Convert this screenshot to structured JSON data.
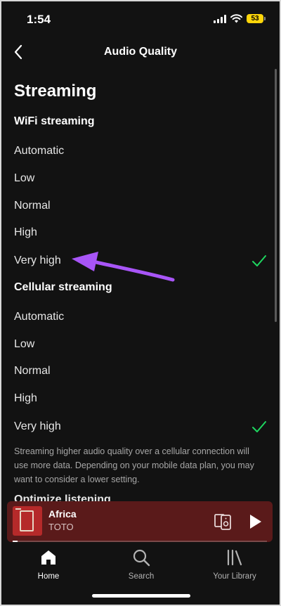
{
  "status_bar": {
    "time": "1:54",
    "battery": "53"
  },
  "header": {
    "title": "Audio Quality"
  },
  "streaming": {
    "section_title": "Streaming",
    "wifi": {
      "title": "WiFi streaming",
      "options": [
        "Automatic",
        "Low",
        "Normal",
        "High",
        "Very high"
      ],
      "selected": "Very high"
    },
    "cellular": {
      "title": "Cellular streaming",
      "options": [
        "Automatic",
        "Low",
        "Normal",
        "High",
        "Very high"
      ],
      "selected": "Very high"
    },
    "helper_text": "Streaming higher audio quality over a cellular connection will use more data. Depending on your mobile data plan, you may want to consider a lower setting."
  },
  "next_section": {
    "title": "Optimize listening"
  },
  "now_playing": {
    "title": "Africa",
    "artist": "TOTO",
    "progress": 0.02
  },
  "tabs": [
    {
      "label": "Home",
      "icon": "home-icon",
      "active": true
    },
    {
      "label": "Search",
      "icon": "search-icon",
      "active": false
    },
    {
      "label": "Your Library",
      "icon": "library-icon",
      "active": false
    }
  ],
  "colors": {
    "background": "#121212",
    "check": "#1ed760",
    "annotation_arrow": "#a855f7",
    "mini_player": "#5a1a1a"
  }
}
